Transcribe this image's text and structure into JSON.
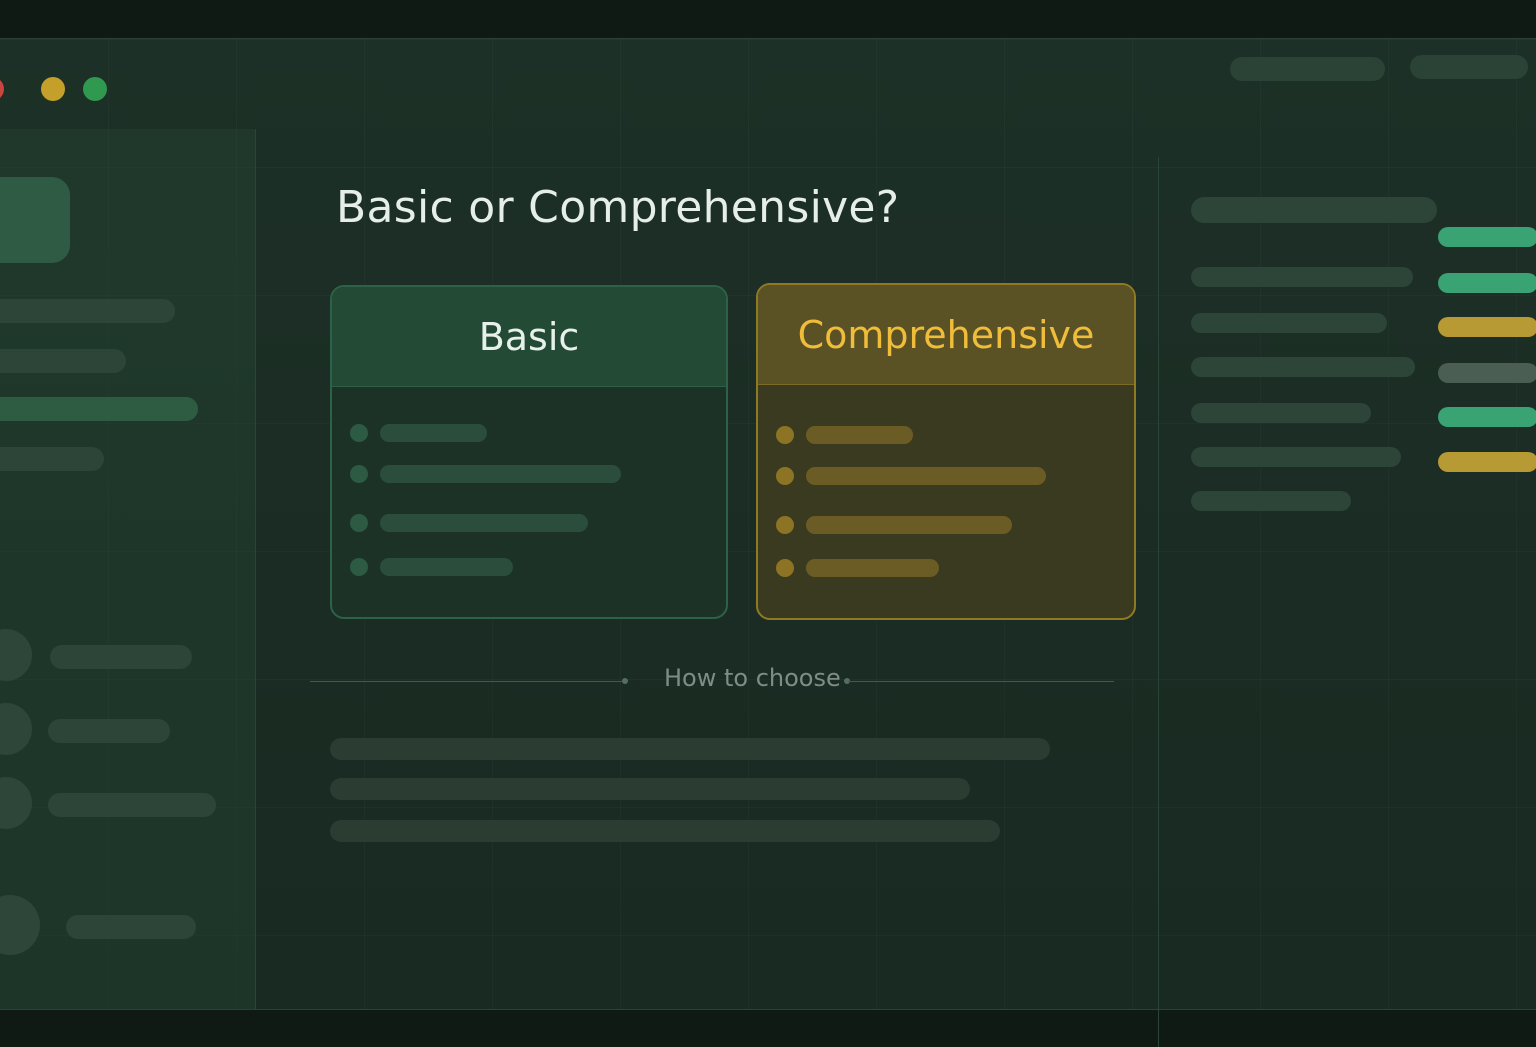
{
  "colors": {
    "accent_green": "#2f9a4f",
    "accent_gold": "#f0bd3a",
    "window_close": "#c9453d",
    "window_minimize": "#c4a02a",
    "window_maximize": "#2f9a4f"
  },
  "page": {
    "title": "Basic or Comprehensive?"
  },
  "options": [
    {
      "label": "Basic",
      "state": "default"
    },
    {
      "label": "Comprehensive",
      "state": "highlighted"
    }
  ],
  "divider": {
    "label": "How to choose"
  },
  "right_panel": {
    "tag_colors": [
      "#3aa373",
      "#3aa373",
      "#b79a34",
      "#4a5e54",
      "#3aa373",
      "#b79a34"
    ]
  }
}
